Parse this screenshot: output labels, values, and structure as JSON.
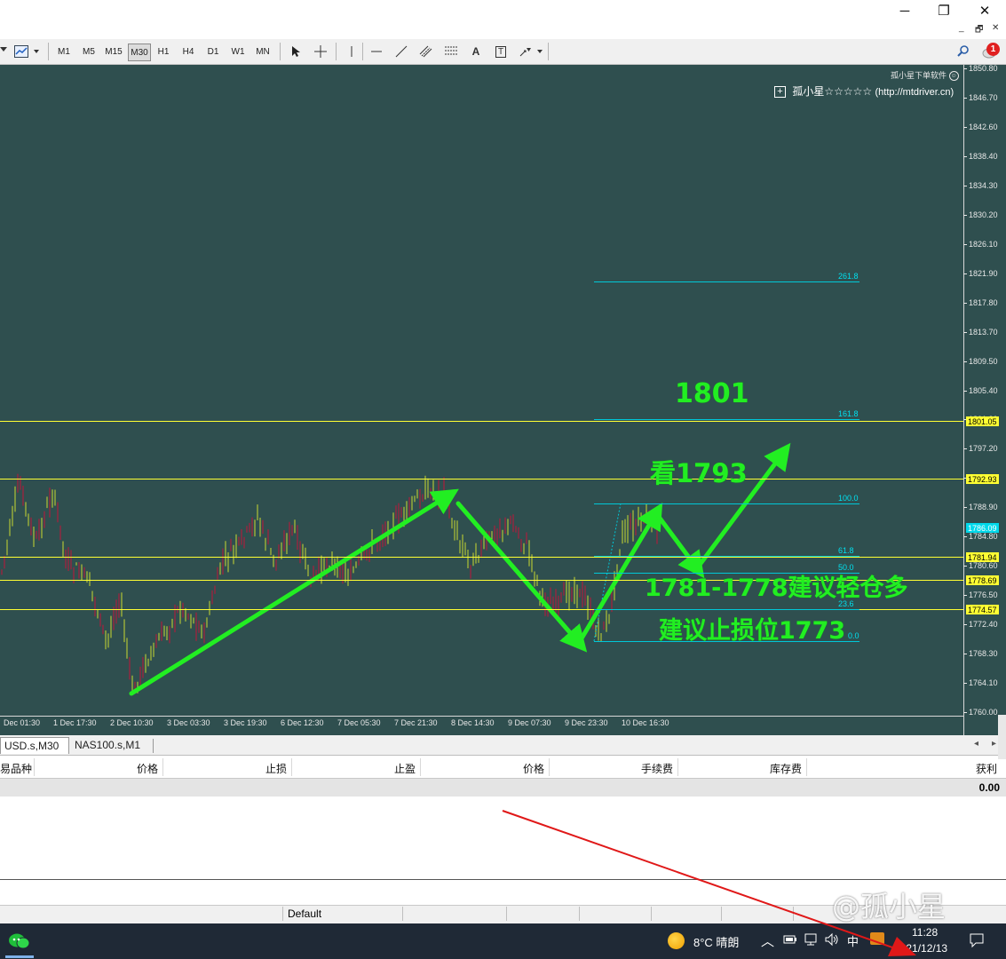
{
  "window": {
    "minimize_glyph": "─",
    "restore_glyph": "❐",
    "close_glyph": "✕",
    "mdi_min": "_",
    "mdi_restore": "🗗",
    "mdi_close": "✕"
  },
  "toolbar": {
    "timeframes": [
      "M1",
      "M5",
      "M15",
      "M30",
      "H1",
      "H4",
      "D1",
      "W1",
      "MN"
    ],
    "active_timeframe": "M30",
    "tool_icons": [
      "cursor-icon",
      "crosshair-icon",
      "vertical-line-icon",
      "horizontal-line-icon",
      "trendline-icon",
      "channel-icon",
      "fibonacci-icon",
      "text-icon",
      "text-label-icon",
      "arrows-icon"
    ],
    "text_tool": "A",
    "text_label_tool": "T",
    "notification_count": "1"
  },
  "chart": {
    "watermark": "孤小星下单软件",
    "indicator_name": "孤小星☆☆☆☆☆",
    "indicator_url": "(http://mtdriver.cn)",
    "expand_glyph": "+",
    "price_ticks": [
      "1850.80",
      "1846.70",
      "1842.60",
      "1838.40",
      "1834.30",
      "1830.20",
      "1826.10",
      "1821.90",
      "1817.80",
      "1813.70",
      "1809.50",
      "1805.40",
      "1801.30",
      "1797.20",
      "1793.00",
      "1788.90",
      "1784.80",
      "1780.60",
      "1776.50",
      "1772.40",
      "1768.30",
      "1764.10",
      "1760.00"
    ],
    "time_ticks": [
      "Dec 01:30",
      "1 Dec 17:30",
      "2 Dec 10:30",
      "3 Dec 03:30",
      "3 Dec 19:30",
      "6 Dec 12:30",
      "7 Dec 05:30",
      "7 Dec 21:30",
      "8 Dec 14:30",
      "9 Dec 07:30",
      "9 Dec 23:30",
      "10 Dec 16:30"
    ],
    "level_boxes": [
      {
        "price": "1801.05",
        "style": "yellow"
      },
      {
        "price": "1792.93",
        "style": "yellow"
      },
      {
        "price": "1786.09",
        "style": "cyan"
      },
      {
        "price": "1781.94",
        "style": "yellow"
      },
      {
        "price": "1778.69",
        "style": "yellow"
      },
      {
        "price": "1774.57",
        "style": "yellow"
      }
    ],
    "fib_levels": [
      "261.8",
      "161.8",
      "100.0",
      "61.8",
      "50.0",
      "23.6",
      "0.0"
    ],
    "annotations": {
      "target_1801": "1801",
      "target_1793": "看1793",
      "buy_zone": "1781-1778建议轻仓多",
      "stop_loss": "建议止损位1773"
    },
    "colors": {
      "background": "#2f4f4f",
      "bull": "#c8d830",
      "bear": "#c0163a",
      "level": "#ffff33",
      "fib": "#00c8d8",
      "arrow": "#22ee22"
    }
  },
  "tabs": [
    "USD.s,M30",
    "NAS100.s,M1"
  ],
  "terminal": {
    "columns": [
      "易品种",
      "价格",
      "止损",
      "止盈",
      "价格",
      "手续费",
      "库存费",
      "获利"
    ],
    "total": "0.00"
  },
  "statusbar": {
    "profile": "Default"
  },
  "taskbar": {
    "weather": "8°C  晴朗",
    "ime": "中",
    "time": "11:28",
    "date": "2021/12/13",
    "watermark": "@孤小星"
  }
}
